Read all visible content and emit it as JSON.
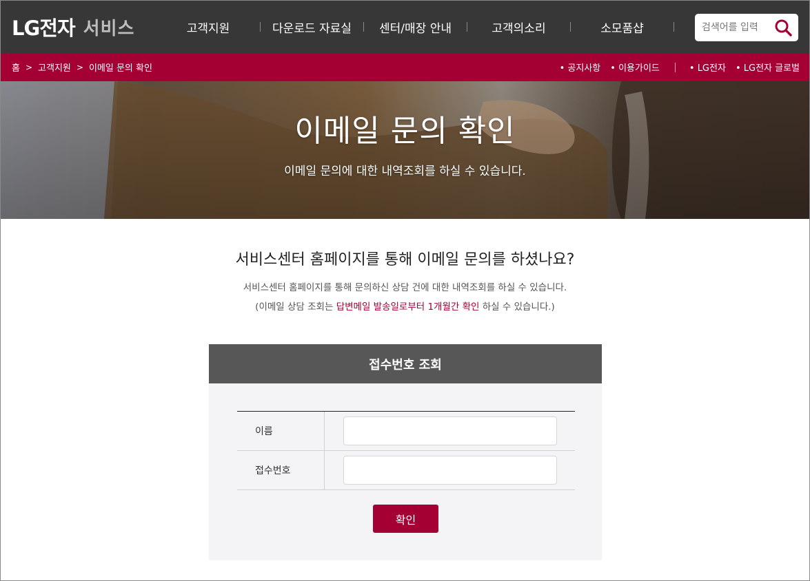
{
  "header": {
    "logo_main": "LG전자",
    "logo_sub": "서비스",
    "nav": [
      "고객지원",
      "다운로드 자료실",
      "센터/매장 안내",
      "고객의소리",
      "소모품샵"
    ],
    "search_placeholder": "검색어를 입력"
  },
  "breadcrumb": {
    "items": [
      "홈",
      "고객지원",
      "이메일 문의 확인"
    ],
    "separator": ">",
    "util_links": [
      "공지사항",
      "이용가이드"
    ],
    "util_links_right": [
      "LG전자",
      "LG전자 글로벌"
    ]
  },
  "hero": {
    "title": "이메일 문의 확인",
    "subtitle": "이메일 문의에 대한 내역조회를 하실 수 있습니다."
  },
  "content": {
    "question": "서비스센터 홈페이지를 통해 이메일 문의를 하셨나요?",
    "desc1": "서비스센터 홈페이지를 통해 문의하신 상담 건에 대한 내역조회를 하실 수 있습니다.",
    "desc2_pre": "(이메일 상담 조회는 ",
    "desc2_highlight": "답변메일 발송일로부터 1개월간 확인",
    "desc2_post": " 하실 수 있습니다.)"
  },
  "form": {
    "panel_title": "접수번호 조회",
    "name_label": "이름",
    "name_value": "",
    "receipt_label": "접수번호",
    "receipt_value": "",
    "submit_label": "확인"
  },
  "colors": {
    "header_bg": "#373737",
    "brand": "#a50034",
    "panel_head": "#575757",
    "panel_bg": "#f4f4f6"
  }
}
